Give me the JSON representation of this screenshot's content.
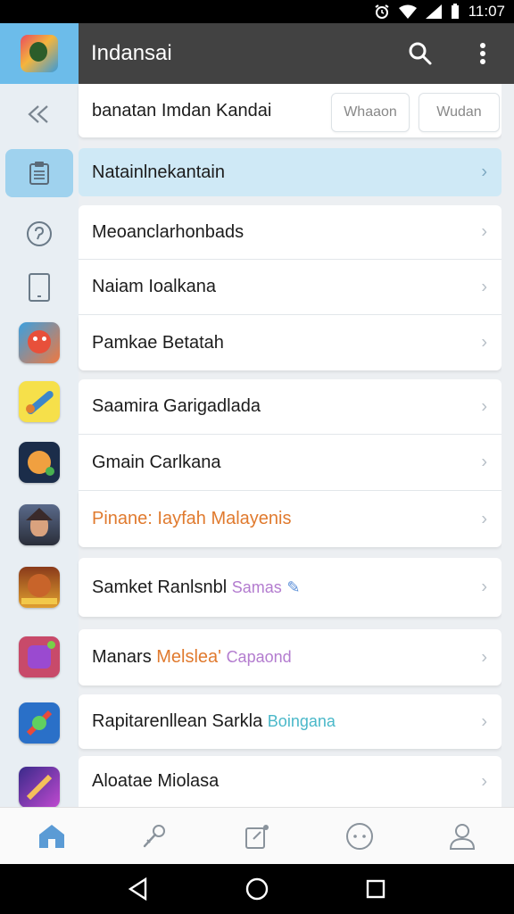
{
  "status_bar": {
    "time": "11:07"
  },
  "app_bar": {
    "title": "Indansai"
  },
  "header": {
    "text": "banatan Imdan Kandai",
    "button_1": "Whaaon",
    "button_2": "Wudan"
  },
  "menu": {
    "highlighted": "Natainlnekantain",
    "card1": [
      "Meoanclarhonbads",
      "Naiam Ioalkana",
      "Pamkae Betatah"
    ],
    "card2": [
      "Saamira Garigadlada",
      "Gmain Carlkana"
    ],
    "card2_row3": {
      "part1": "Pinane: Iayfah",
      "part2": "Malayenis"
    },
    "row_single_1": {
      "part1": "Samket Ranlsnbl",
      "part2": "Samas"
    },
    "row_single_2": {
      "part1": "Manars",
      "part2": "Melslea'",
      "part3": "Capaond"
    },
    "row_single_3": {
      "part1": "Rapitarenllean Sarkla",
      "part2": "Boingana"
    },
    "row_single_4": "Aloatae Miolasa"
  },
  "colors": {
    "app_bar": "#424242",
    "rail": "#e8eef3",
    "highlight": "#cfe9f6",
    "accent_orange": "#e07a2e",
    "accent_purple": "#b37ccf",
    "accent_cyan": "#4ab8c9",
    "nav_active": "#5b9bd5"
  },
  "icons": {
    "rail": [
      "double-chevron-icon",
      "clipboard-icon",
      "help-icon",
      "tablet-icon",
      "game-icon-red",
      "game-icon-yellow",
      "game-icon-cat",
      "game-icon-warrior",
      "game-icon-demon",
      "game-icon-purple",
      "game-icon-blue",
      "game-icon-violet"
    ],
    "bottom_nav": [
      "home-icon",
      "pin-icon",
      "clipboard-edit-icon",
      "chat-icon",
      "user-icon"
    ]
  }
}
